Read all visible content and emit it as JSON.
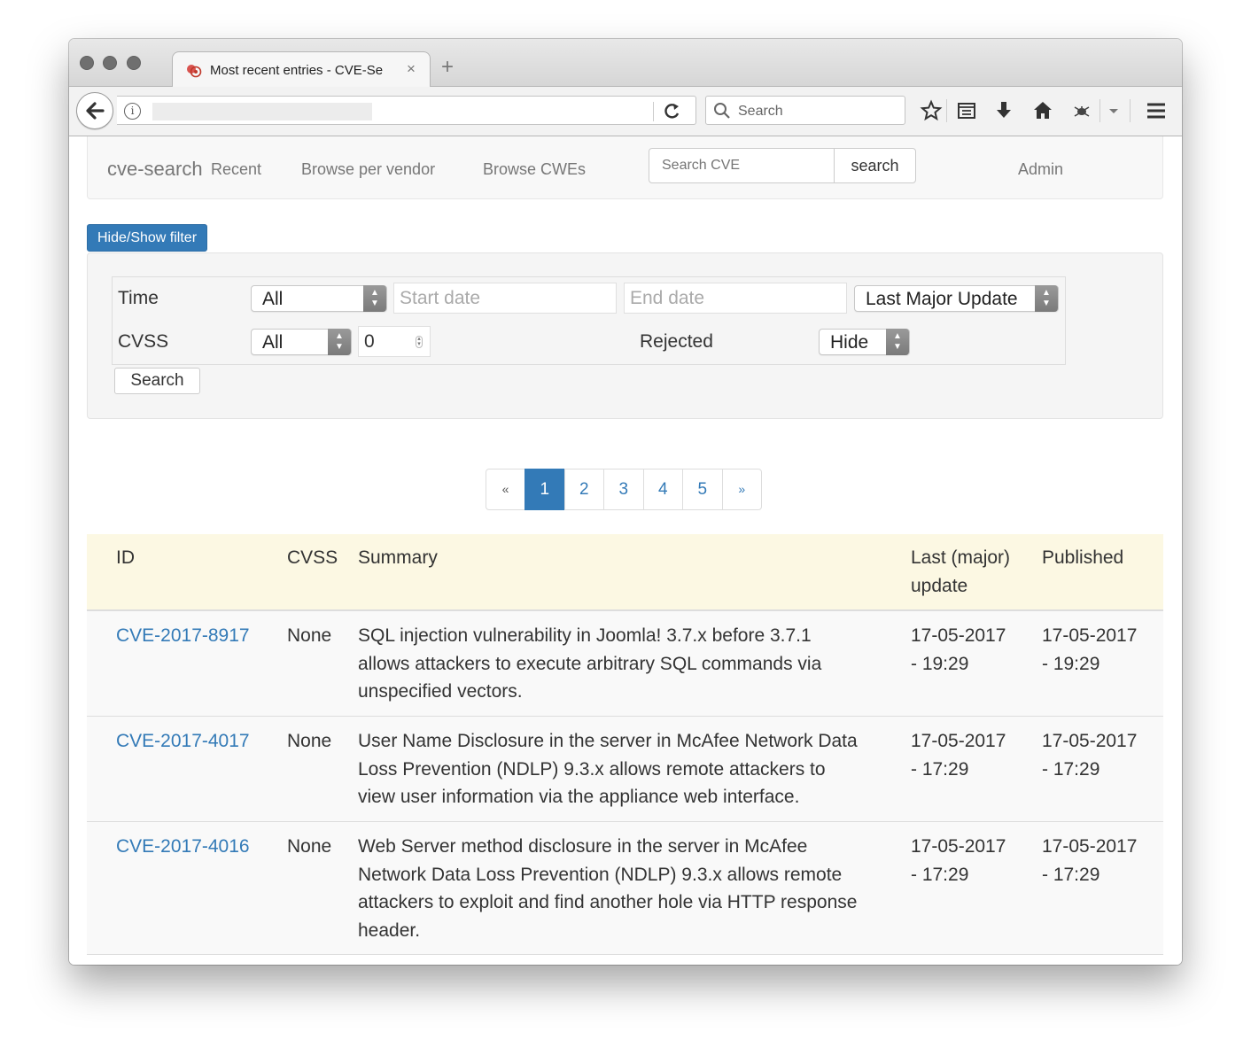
{
  "browser": {
    "tab_title": "Most recent entries - CVE-Se",
    "tab_close": "×",
    "new_tab": "+",
    "search_placeholder": "Search"
  },
  "navbar": {
    "brand": "cve-search",
    "links": [
      "Recent",
      "Browse per vendor",
      "Browse CWEs"
    ],
    "search_placeholder": "Search CVE",
    "search_button": "search",
    "admin": "Admin"
  },
  "filter": {
    "toggle_button": "Hide/Show filter",
    "time_label": "Time",
    "time_select": "All",
    "start_date_placeholder": "Start date",
    "end_date_placeholder": "End date",
    "time_type_select": "Last Major Update",
    "cvss_label": "CVSS",
    "cvss_select": "All",
    "cvss_value": "0",
    "rejected_label": "Rejected",
    "rejected_select": "Hide",
    "search_button": "Search"
  },
  "pagination": {
    "prev": "«",
    "pages": [
      "1",
      "2",
      "3",
      "4",
      "5"
    ],
    "active_page": "1",
    "next": "»"
  },
  "table": {
    "headers": {
      "id": "ID",
      "cvss": "CVSS",
      "summary": "Summary",
      "last_update_line1": "Last (major)",
      "last_update_line2": "update",
      "published": "Published"
    },
    "rows": [
      {
        "id": "CVE-2017-8917",
        "cvss": "None",
        "summary_lines": [
          "SQL injection vulnerability in Joomla! 3.7.x before 3.7.1",
          "allows attackers to execute arbitrary SQL commands via",
          "unspecified vectors."
        ],
        "last_update": [
          "17-05-2017",
          "- 19:29"
        ],
        "published": [
          "17-05-2017",
          "- 19:29"
        ]
      },
      {
        "id": "CVE-2017-4017",
        "cvss": "None",
        "summary_lines": [
          "User Name Disclosure in the server in McAfee Network Data",
          "Loss Prevention (NDLP) 9.3.x allows remote attackers to",
          "view user information via the appliance web interface."
        ],
        "last_update": [
          "17-05-2017",
          "- 17:29"
        ],
        "published": [
          "17-05-2017",
          "- 17:29"
        ]
      },
      {
        "id": "CVE-2017-4016",
        "cvss": "None",
        "summary_lines": [
          "Web Server method disclosure in the server in McAfee",
          "Network Data Loss Prevention (NDLP) 9.3.x allows remote",
          "attackers to exploit and find another hole via HTTP response",
          "header."
        ],
        "last_update": [
          "17-05-2017",
          "- 17:29"
        ],
        "published": [
          "17-05-2017",
          "- 17:29"
        ]
      }
    ]
  },
  "colors": {
    "primary": "#337ab7",
    "table_header_bg": "#fcf8e3",
    "navbar_bg": "#f8f8f8",
    "well_bg": "#f5f5f5"
  }
}
